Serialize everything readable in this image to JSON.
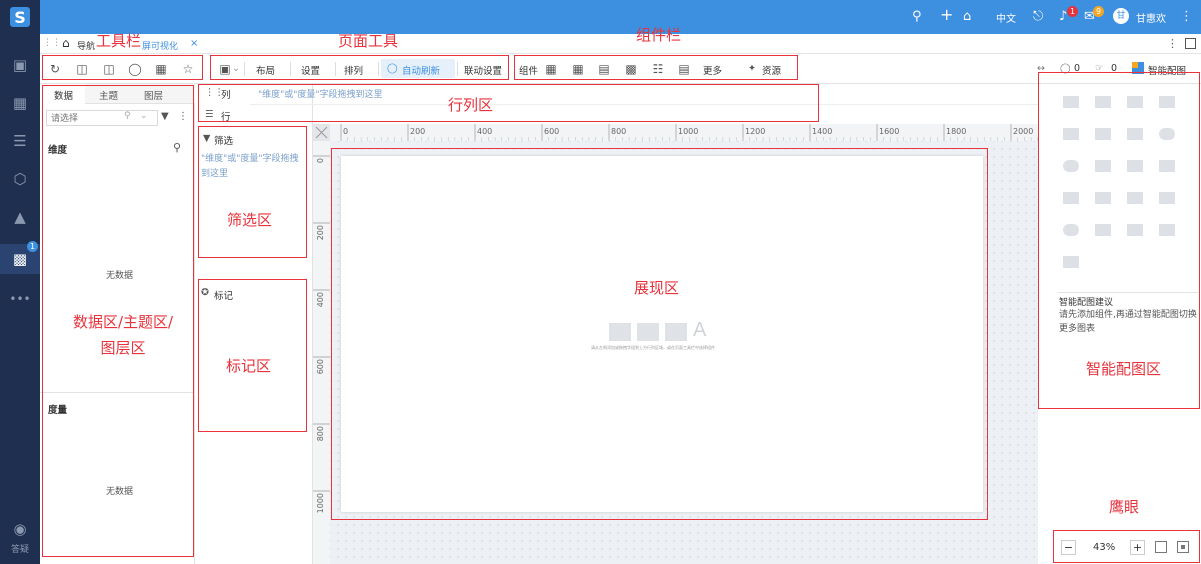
{
  "topbar": {
    "lang": "中文",
    "notify_count": "1",
    "message_count": "9",
    "avatar_text": "甘",
    "username": "甘惠欢"
  },
  "sidebar": {
    "badge": "1",
    "help_label": "答疑"
  },
  "tab": {
    "home_text": "导航",
    "active_tab": "屏可视化",
    "close": "×"
  },
  "toolbar": {
    "layout": "布局",
    "settings": "设置",
    "arrange": "排列",
    "auto_refresh": "自动刷新",
    "link_settings": "联动设置",
    "component": "组件",
    "more": "更多",
    "resources": "资源",
    "comment_count": "0",
    "like_count": "0",
    "smart_chart": "智能配图"
  },
  "left": {
    "tabs": [
      "数据",
      "主题",
      "图层"
    ],
    "search_placeholder": "请选择",
    "dimension": "维度",
    "measure": "度量",
    "no_data_1": "无数据",
    "no_data_2": "无数据"
  },
  "fields": {
    "col": "列",
    "row": "行",
    "drag_hint": "\"维度\"或\"度量\"字段拖拽到这里",
    "filter": "筛选",
    "filter_hint": "\"维度\"或\"度量\"字段拖拽到这里",
    "mark": "标记"
  },
  "ruler": {
    "h": [
      "0",
      "200",
      "400",
      "600",
      "800",
      "1000",
      "1200",
      "1400",
      "1600",
      "1800",
      "2000"
    ],
    "v": [
      "0",
      "200",
      "400",
      "600",
      "800",
      "1000"
    ]
  },
  "canvas": {
    "hint": "请从左侧添加或拖拽字段到上方行列区域，或在页面工具栏中选择组件"
  },
  "right": {
    "suggest_title": "智能配图建议",
    "suggest_text": "请先添加组件,再通过智能配图切换更多图表"
  },
  "zoom": {
    "minus": "−",
    "value": "43%",
    "plus": "+"
  },
  "annotations": {
    "toolbar": "工具栏",
    "page_tools": "页面工具",
    "component_bar": "组件栏",
    "rowcol": "行列区",
    "filter_area": "筛选区",
    "mark_area": "标记区",
    "display_area": "展现区",
    "data_area": "数据区/主题区/\n图层区",
    "smart_area": "智能配图区",
    "eagle_eye": "鹰眼"
  },
  "colors": {
    "topbar": "#3d8fe0",
    "sidebar": "#1e2f4f",
    "annotation": "#e8323c"
  }
}
